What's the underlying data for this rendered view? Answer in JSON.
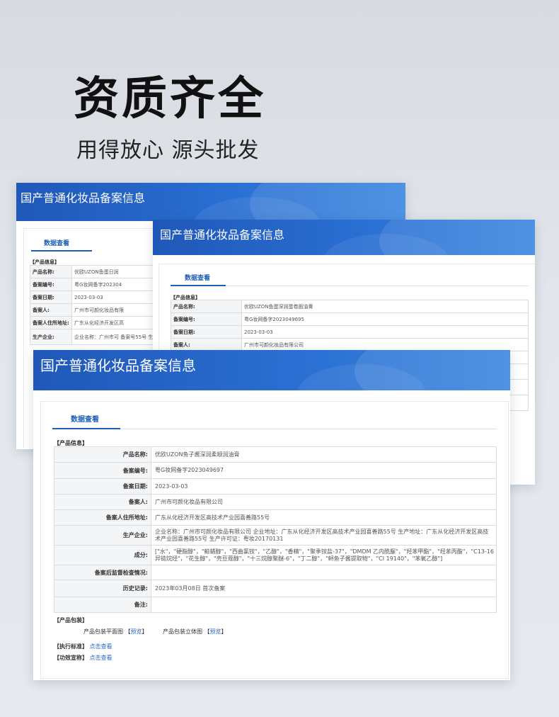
{
  "hero": {
    "title": "资质齐全",
    "subtitle": "用得放心 源头批发"
  },
  "banner_title": "国产普通化妆品备案信息",
  "tab_label": "数据查看",
  "section_product_info": "【产品信息】",
  "back_card": {
    "rows": [
      {
        "label": "产品名称:",
        "value": "优欧UZON鱼蛋日润"
      },
      {
        "label": "备案编号:",
        "value": "粤G妆网备字202304"
      },
      {
        "label": "备案日期:",
        "value": "2023-03-03"
      },
      {
        "label": "备案人:",
        "value": "广州市可颜化妆品有限"
      },
      {
        "label": "备案人住所地址:",
        "value": "广东从化经济开发区高"
      },
      {
        "label": "生产企业:",
        "value": "企业名称：广州市可 备案号55号 生产许可"
      }
    ]
  },
  "middle_card": {
    "rows": [
      {
        "label": "产品名称:",
        "value": "优欧UZON鱼蛋深润蛋卷面油膏"
      },
      {
        "label": "备案编号:",
        "value": "粤G妆网备字2023049695"
      },
      {
        "label": "备案日期:",
        "value": "2023-03-03"
      },
      {
        "label": "备案人:",
        "value": "广州市可颜化妆品有限公司"
      }
    ]
  },
  "front_card": {
    "rows": [
      {
        "label": "产品名称:",
        "value": "优欧UZON鱼子酱深润柔顺润油膏"
      },
      {
        "label": "备案编号:",
        "value": "粤G妆网备字2023049697"
      },
      {
        "label": "备案日期:",
        "value": "2023-03-03"
      },
      {
        "label": "备案人:",
        "value": "广州市可颜化妆品有限公司"
      },
      {
        "label": "备案人住所地址:",
        "value": "广东从化经济开发区高技术产业园喜善路55号"
      },
      {
        "label": "生产企业:",
        "value": "企业名称：广州市可颜化妆品有限公司 企业地址：广东从化经济开发区高技术产业园喜善路55号 生产地址：广东从化经济开发区高技术产业园喜善路55号 生产许可证：粤妆20170131"
      },
      {
        "label": "成分:",
        "value": "[\"水\"，\"硬脂醇\"，\"鲸蜡醇\"，\"西曲氯铵\"，\"乙醇\"，\"香精\"，\"聚季铵盐-37\"，\"DMDM 乙内酰脲\"，\"羟苯甲酯\"，\"羟苯丙酯\"，\"C13-16 异链烷烃\"，\"花生醇\"，\"壳豆蔻醇\"，\"十三烷醇聚醚-6\"，\"丁二醇\"，\"鲟鱼子酱提取物\"，\"CI 19140\"，\"苯氧乙醇\"]"
      },
      {
        "label": "备案后监督检查情况:",
        "value": ""
      },
      {
        "label": "历史记录:",
        "value": "2023年03月08日 首次备案"
      },
      {
        "label": "备注:",
        "value": ""
      }
    ],
    "packaging_label": "【产品包装】",
    "packaging_flat": "产品包装平面图",
    "packaging_3d": "产品包装立体图",
    "preview_link": "预览",
    "standard_label": "【执行标准】",
    "efficacy_label": "【功效宣称】",
    "view_link": "点击查看"
  }
}
